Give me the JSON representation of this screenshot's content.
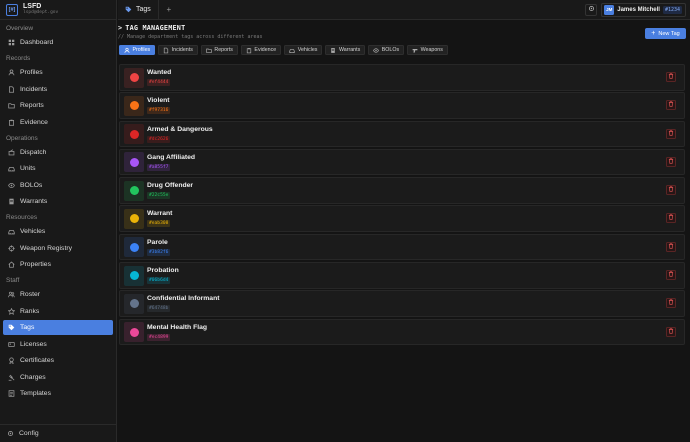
{
  "brand": {
    "logo": "[#]",
    "name": "LSFD",
    "email": "lspd@dept.gov"
  },
  "sidebar": {
    "sections": [
      {
        "title": "Overview",
        "items": [
          {
            "label": "Dashboard",
            "icon": "grid-icon"
          }
        ]
      },
      {
        "title": "Records",
        "items": [
          {
            "label": "Profiles",
            "icon": "user-icon"
          },
          {
            "label": "Incidents",
            "icon": "file-icon"
          },
          {
            "label": "Reports",
            "icon": "folder-icon"
          },
          {
            "label": "Evidence",
            "icon": "clipboard-icon"
          }
        ]
      },
      {
        "title": "Operations",
        "items": [
          {
            "label": "Dispatch",
            "icon": "radio-icon"
          },
          {
            "label": "Units",
            "icon": "car-icon"
          },
          {
            "label": "BOLOs",
            "icon": "eye-icon"
          },
          {
            "label": "Warrants",
            "icon": "doc-icon"
          }
        ]
      },
      {
        "title": "Resources",
        "items": [
          {
            "label": "Vehicles",
            "icon": "car-icon"
          },
          {
            "label": "Weapon Registry",
            "icon": "crosshair-icon"
          },
          {
            "label": "Properties",
            "icon": "home-icon"
          }
        ]
      },
      {
        "title": "Staff",
        "items": [
          {
            "label": "Roster",
            "icon": "users-icon"
          },
          {
            "label": "Ranks",
            "icon": "star-icon"
          },
          {
            "label": "Tags",
            "icon": "tag-icon",
            "active": true
          },
          {
            "label": "Licenses",
            "icon": "card-icon"
          },
          {
            "label": "Certificates",
            "icon": "award-icon"
          },
          {
            "label": "Charges",
            "icon": "gavel-icon"
          },
          {
            "label": "Templates",
            "icon": "template-icon"
          }
        ]
      }
    ],
    "footer": {
      "label": "Config"
    }
  },
  "topbar": {
    "tab_label": "Tags",
    "add_tab": "+",
    "user": {
      "initials": "JM",
      "name": "James Mitchell",
      "badge": "#1234"
    }
  },
  "header": {
    "title": "TAG MANAGEMENT",
    "subtitle": "// Manage department tags across different areas",
    "new_button": "New Tag"
  },
  "filters": [
    {
      "label": "Profiles",
      "icon": "user-icon",
      "active": true
    },
    {
      "label": "Incidents",
      "icon": "file-icon"
    },
    {
      "label": "Reports",
      "icon": "folder-icon"
    },
    {
      "label": "Evidence",
      "icon": "clipboard-icon"
    },
    {
      "label": "Vehicles",
      "icon": "car-icon"
    },
    {
      "label": "Warrants",
      "icon": "doc-icon"
    },
    {
      "label": "BOLOs",
      "icon": "eye-icon"
    },
    {
      "label": "Weapons",
      "icon": "gun-icon"
    }
  ],
  "tags": [
    {
      "name": "Wanted",
      "hex": "#ef4444",
      "color": "#ef4444"
    },
    {
      "name": "Violent",
      "hex": "#f97316",
      "color": "#f97316"
    },
    {
      "name": "Armed & Dangerous",
      "hex": "#dc2626",
      "color": "#dc2626"
    },
    {
      "name": "Gang Affiliated",
      "hex": "#a855f7",
      "color": "#a855f7"
    },
    {
      "name": "Drug Offender",
      "hex": "#22c55e",
      "color": "#22c55e"
    },
    {
      "name": "Warrant",
      "hex": "#eab308",
      "color": "#eab308"
    },
    {
      "name": "Parole",
      "hex": "#3b82f6",
      "color": "#3b82f6"
    },
    {
      "name": "Probation",
      "hex": "#06b6d4",
      "color": "#06b6d4"
    },
    {
      "name": "Confidential Informant",
      "hex": "#64748b",
      "color": "#64748b"
    },
    {
      "name": "Mental Health Flag",
      "hex": "#ec4899",
      "color": "#ec4899"
    }
  ]
}
